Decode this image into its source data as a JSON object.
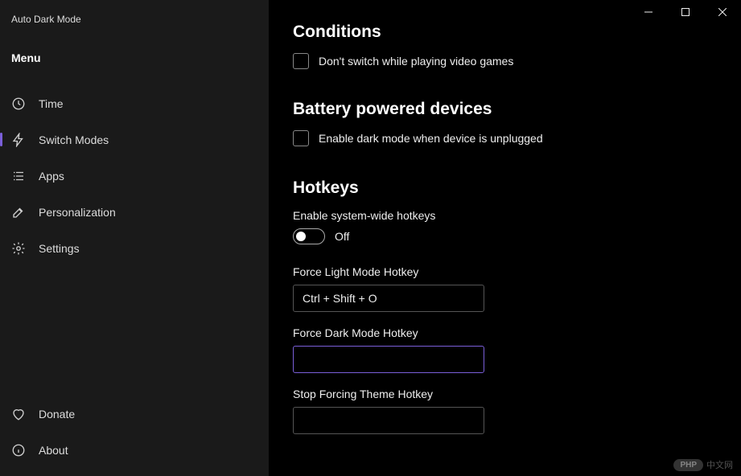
{
  "app": {
    "title": "Auto Dark Mode"
  },
  "sidebar": {
    "menuHeader": "Menu",
    "items": [
      {
        "label": "Time"
      },
      {
        "label": "Switch Modes"
      },
      {
        "label": "Apps"
      },
      {
        "label": "Personalization"
      },
      {
        "label": "Settings"
      }
    ],
    "bottom": [
      {
        "label": "Donate"
      },
      {
        "label": "About"
      }
    ]
  },
  "main": {
    "conditions": {
      "heading": "Conditions",
      "checkbox1": "Don't switch while playing video games"
    },
    "battery": {
      "heading": "Battery powered devices",
      "checkbox1": "Enable dark mode when device is unplugged"
    },
    "hotkeys": {
      "heading": "Hotkeys",
      "enableLabel": "Enable system-wide hotkeys",
      "toggleState": "Off",
      "lightLabel": "Force Light Mode Hotkey",
      "lightValue": "Ctrl + Shift + O",
      "darkLabel": "Force Dark Mode Hotkey",
      "darkValue": "",
      "stopLabel": "Stop Forcing Theme Hotkey",
      "stopValue": ""
    }
  },
  "watermark": {
    "badge": "PHP",
    "text": "中文网"
  }
}
